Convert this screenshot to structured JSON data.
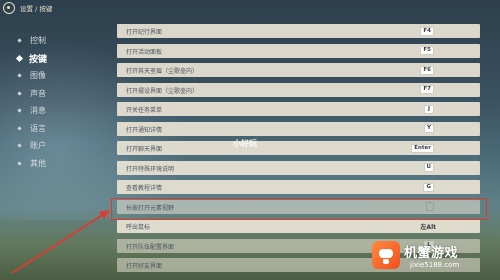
{
  "header": {
    "breadcrumb": "设置 / 按键"
  },
  "sidebar": {
    "items": [
      {
        "label": "控制",
        "active": false
      },
      {
        "label": "按键",
        "active": true
      },
      {
        "label": "图像",
        "active": false
      },
      {
        "label": "声音",
        "active": false
      },
      {
        "label": "消息",
        "active": false
      },
      {
        "label": "语言",
        "active": false
      },
      {
        "label": "账户",
        "active": false
      },
      {
        "label": "其他",
        "active": false
      }
    ]
  },
  "keybinds": [
    {
      "label": "打开纪行界面",
      "key": "F4"
    },
    {
      "label": "打开活动面板",
      "key": "F5"
    },
    {
      "label": "打开其天室眉（尘歌壶内）",
      "key": "F6"
    },
    {
      "label": "打开摆设界面（尘歌壶内）",
      "key": "F7"
    },
    {
      "label": "开关任务菜单",
      "key": "J"
    },
    {
      "label": "打开通知详情",
      "key": "Y"
    },
    {
      "label": "打开聊天界面",
      "key": "Enter"
    },
    {
      "label": "打开特殊环境说明",
      "key": "U"
    },
    {
      "label": "查看教程详情",
      "key": "G"
    },
    {
      "label": "长按打开元素视野",
      "key": ""
    },
    {
      "label": "呼出鼠标",
      "key": "左Alt"
    },
    {
      "label": "打开队伍配置界面",
      "key": "L"
    },
    {
      "label": "打开好友界面",
      "key": ""
    }
  ],
  "watermark": "小好玩",
  "brand": {
    "name": "机蟹游戏",
    "url": "jixie5188.com"
  },
  "colors": {
    "highlight_border": "#e03a2e",
    "row_bg": "#e8e2d4",
    "brand_orange": "#f24e1e"
  }
}
